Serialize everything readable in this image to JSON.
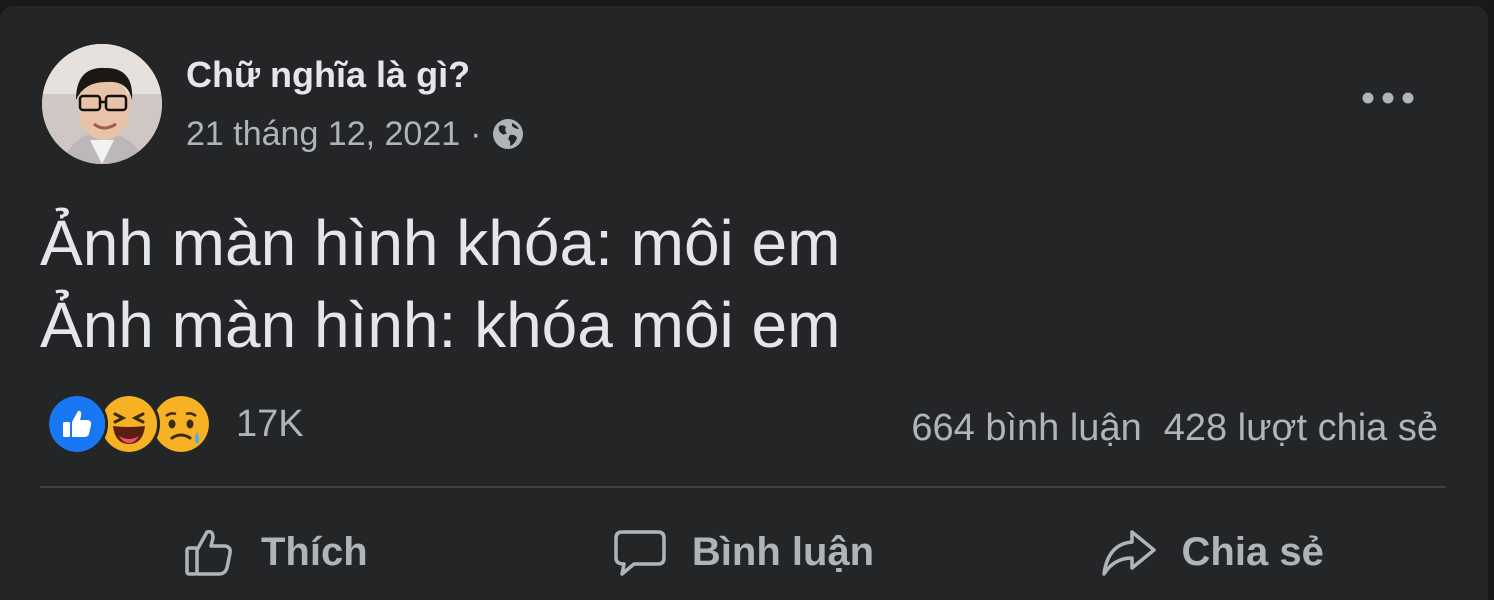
{
  "post": {
    "author_name": "Chữ nghĩa là gì?",
    "date": "21 tháng 12, 2021",
    "separator": "·",
    "privacy_icon": "globe-icon",
    "text_line_1": "Ảnh màn hình khóa: môi em",
    "text_line_2": "Ảnh màn hình: khóa môi em"
  },
  "reactions": {
    "icons": [
      "like-icon",
      "haha-icon",
      "sad-icon"
    ],
    "count": "17K"
  },
  "stats": {
    "comments": "664 bình luận",
    "shares": "428 lượt chia sẻ"
  },
  "actions": {
    "like_label": "Thích",
    "comment_label": "Bình luận",
    "share_label": "Chia sẻ"
  },
  "colors": {
    "background": "#18191a",
    "card": "#242526",
    "text_primary": "#e4e6eb",
    "text_secondary": "#b0b3b8",
    "like_blue": "#1877f2",
    "emoji_yellow": "#f7b125"
  }
}
